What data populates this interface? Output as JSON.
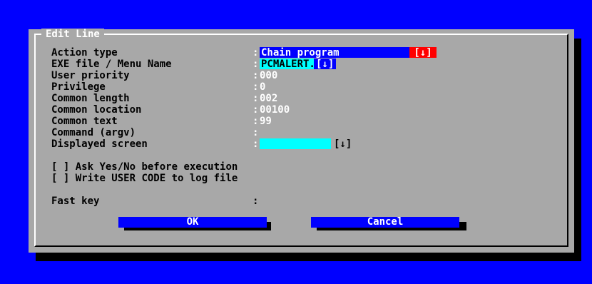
{
  "dialog": {
    "title": "Edit Line",
    "fields": [
      {
        "label": "Action type",
        "value": "Chain program",
        "dropdown": "[↓]"
      },
      {
        "label": "EXE file / Menu Name",
        "value": "PCMALERT.E",
        "dropdown": "[↓]"
      },
      {
        "label": "User priority",
        "value": "000"
      },
      {
        "label": "Privilege",
        "value": "0"
      },
      {
        "label": "Common length",
        "value": "002"
      },
      {
        "label": "Common location",
        "value": "00100"
      },
      {
        "label": "Common text",
        "value": "99"
      },
      {
        "label": "Command (argv)",
        "value": ""
      },
      {
        "label": "Displayed screen",
        "value": "",
        "dropdown": "[↓]"
      }
    ],
    "checkboxes": [
      {
        "box": "[ ]",
        "label": "Ask Yes/No before execution",
        "checked": false
      },
      {
        "box": "[ ]",
        "label": "Write USER CODE to log file",
        "checked": false
      }
    ],
    "fast_key": {
      "label": "Fast key",
      "value": ""
    },
    "colon": ":",
    "buttons": {
      "ok": "OK",
      "cancel_hot": "C",
      "cancel_rest": "ancel"
    }
  },
  "colors": {
    "desktop": "#0000ff",
    "dialog": "#a8a8a8",
    "highlight": "#00ffff",
    "alert": "#ff0000"
  }
}
